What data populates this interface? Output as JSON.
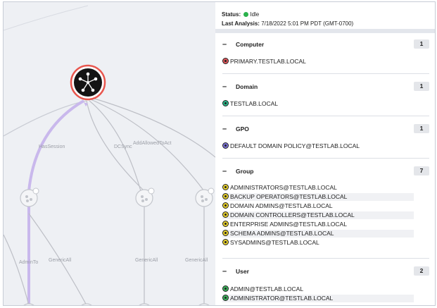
{
  "status": {
    "label": "Status:",
    "value": "Idle",
    "analysis_label": "Last Analysis:",
    "analysis_value": "7/18/2022 5:01 PM PDT (GMT-0700)",
    "indicator_color": "#2bb24c"
  },
  "graph": {
    "edges": {
      "has_session": "HasSession",
      "dcsync": "DCSync",
      "add_allowed": "AddAllowedToAct",
      "admin_to": "AdminTo",
      "generic_all_1": "GenericAll",
      "generic_all_2": "GenericAll",
      "generic_all_3": "GenericAll"
    },
    "highlight_color": "#c9b8ec",
    "target_ring_color": "#e8564e"
  },
  "sections": {
    "computer": {
      "title": "Computer",
      "count": "1",
      "items": [
        "PRIMARY.TESTLAB.LOCAL"
      ],
      "icon": "computer-icon"
    },
    "domain": {
      "title": "Domain",
      "count": "1",
      "items": [
        "TESTLAB.LOCAL"
      ],
      "icon": "domain-icon"
    },
    "gpo": {
      "title": "GPO",
      "count": "1",
      "items": [
        "DEFAULT DOMAIN POLICY@TESTLAB.LOCAL"
      ],
      "icon": "gpo-icon"
    },
    "group": {
      "title": "Group",
      "count": "7",
      "items": [
        "ADMINISTRATORS@TESTLAB.LOCAL",
        "BACKUP OPERATORS@TESTLAB.LOCAL",
        "DOMAIN ADMINS@TESTLAB.LOCAL",
        "DOMAIN CONTROLLERS@TESTLAB.LOCAL",
        "ENTERPRISE ADMINS@TESTLAB.LOCAL",
        "SCHEMA ADMINS@TESTLAB.LOCAL",
        "SYSADMINS@TESTLAB.LOCAL"
      ],
      "icon": "group-icon"
    },
    "user": {
      "title": "User",
      "count": "2",
      "items": [
        "ADMIN@TESTLAB.LOCAL",
        "ADMINISTRATOR@TESTLAB.LOCAL"
      ],
      "icon": "user-icon"
    }
  },
  "collapse_symbol": "–"
}
